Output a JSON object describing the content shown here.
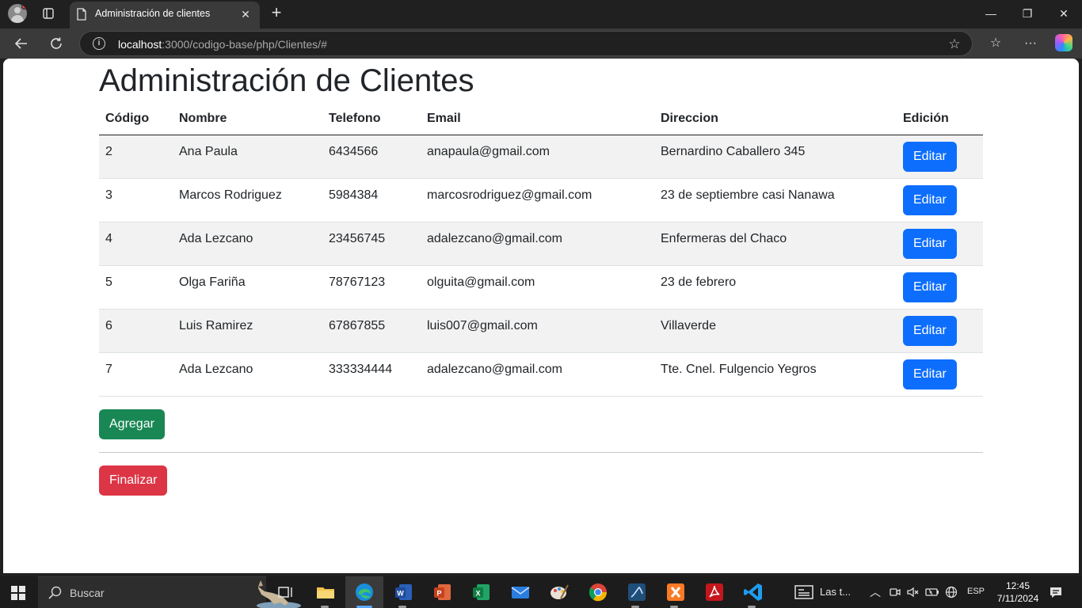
{
  "browser": {
    "tab_title": "Administración de clientes",
    "url_host": "localhost",
    "url_rest": ":3000/codigo-base/php/Clientes/#"
  },
  "page": {
    "title": "Administración de Clientes",
    "columns": [
      "Código",
      "Nombre",
      "Telefono",
      "Email",
      "Direccion",
      "Edición"
    ],
    "rows": [
      {
        "codigo": "2",
        "nombre": "Ana Paula",
        "telefono": "6434566",
        "email": "anapaula@gmail.com",
        "direccion": "Bernardino Caballero 345"
      },
      {
        "codigo": "3",
        "nombre": "Marcos Rodriguez",
        "telefono": "5984384",
        "email": "marcosrodriguez@gmail.com",
        "direccion": "23 de septiembre casi Nanawa"
      },
      {
        "codigo": "4",
        "nombre": "Ada Lezcano",
        "telefono": "23456745",
        "email": "adalezcano@gmail.com",
        "direccion": "Enfermeras del Chaco"
      },
      {
        "codigo": "5",
        "nombre": "Olga Fariña",
        "telefono": "78767123",
        "email": "olguita@gmail.com",
        "direccion": "23 de febrero"
      },
      {
        "codigo": "6",
        "nombre": "Luis Ramirez",
        "telefono": "67867855",
        "email": "luis007@gmail.com",
        "direccion": "Villaverde"
      },
      {
        "codigo": "7",
        "nombre": "Ada Lezcano",
        "telefono": "333334444",
        "email": "adalezcano@gmail.com",
        "direccion": "Tte. Cnel. Fulgencio Yegros"
      }
    ],
    "edit_label": "Editar",
    "add_label": "Agregar",
    "finish_label": "Finalizar",
    "colors": {
      "primary": "#0d6efd",
      "success": "#198754",
      "danger": "#dc3545"
    }
  },
  "taskbar": {
    "search_label": "Buscar",
    "widget_text": "Las t...",
    "language": "ESP",
    "time": "12:45",
    "date": "7/11/2024",
    "apps": [
      "task-view-icon",
      "file-explorer-icon",
      "edge-icon",
      "word-icon",
      "powerpoint-icon",
      "excel-icon",
      "mail-icon",
      "paint-icon",
      "chrome-icon",
      "mysql-workbench-icon",
      "xampp-icon",
      "acrobat-icon",
      "vscode-icon"
    ]
  }
}
